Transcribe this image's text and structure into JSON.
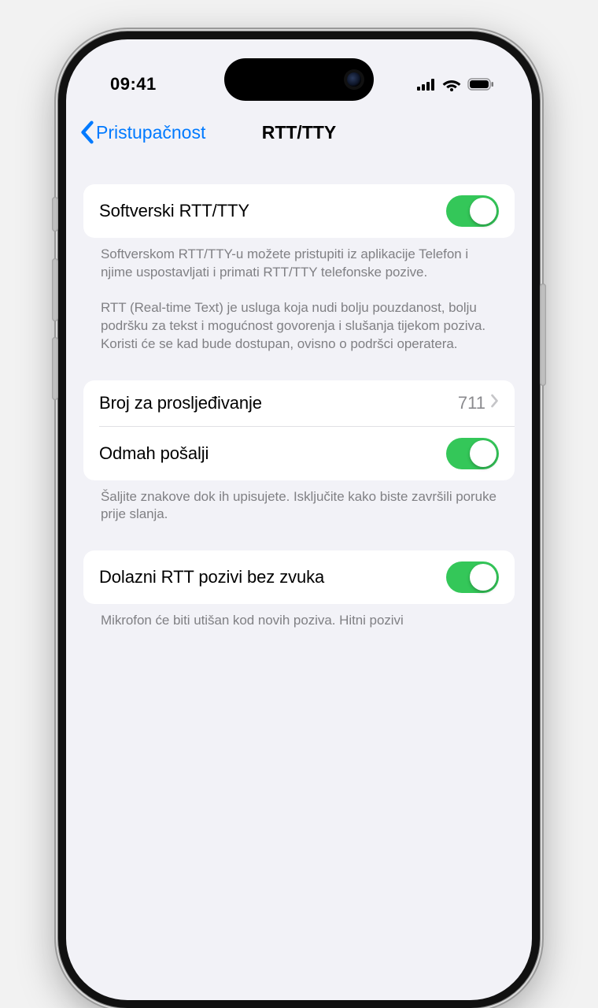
{
  "status": {
    "time": "09:41"
  },
  "nav": {
    "back": "Pristupačnost",
    "title": "RTT/TTY"
  },
  "group1": {
    "software_label": "Softverski RTT/TTY",
    "footer": "Softverskom RTT/TTY-u možete pristupiti iz aplikacije Telefon i njime uspostavljati i primati RTT/TTY telefonske pozive.\n\nRTT (Real-time Text) je usluga koja nudi bolju pouzdanost, bolju podršku za tekst i mogućnost govorenja i slušanja tijekom poziva. Koristi će se kad bude dostupan, ovisno o podršci operatera."
  },
  "group2": {
    "relay_label": "Broj za prosljeđivanje",
    "relay_value": "711",
    "send_now_label": "Odmah pošalji",
    "footer": "Šaljite znakove dok ih upisujete. Isključite kako biste završili poruke prije slanja."
  },
  "group3": {
    "silent_label": "Dolazni RTT pozivi bez zvuka",
    "footer": "Mikrofon će biti utišan kod novih poziva. Hitni pozivi"
  },
  "toggles": {
    "software": true,
    "send_now": true,
    "silent": true
  }
}
